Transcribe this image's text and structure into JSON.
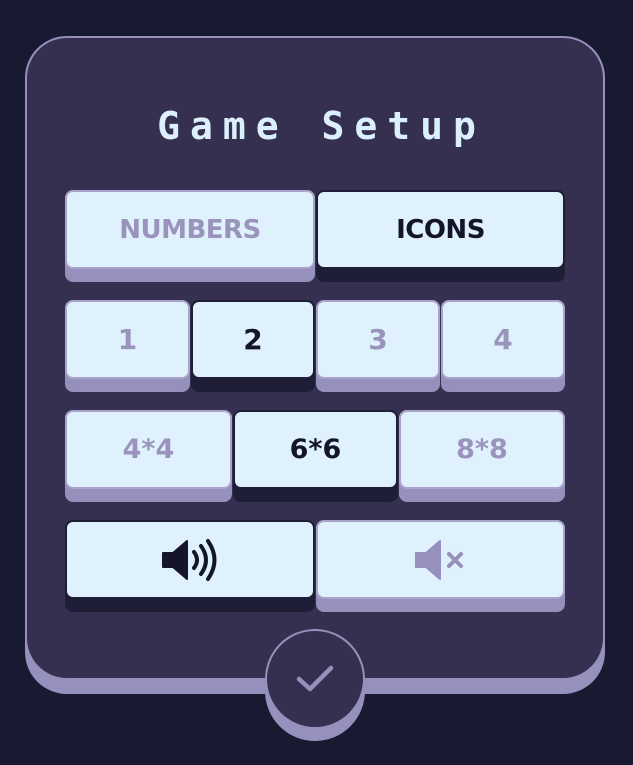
{
  "panel": {
    "title": "Game Setup"
  },
  "theme_row": {
    "options": [
      {
        "label": "NUMBERS",
        "selected": false
      },
      {
        "label": "ICONS",
        "selected": true
      }
    ]
  },
  "players_row": {
    "options": [
      {
        "label": "1",
        "selected": false
      },
      {
        "label": "2",
        "selected": true
      },
      {
        "label": "3",
        "selected": false
      },
      {
        "label": "4",
        "selected": false
      }
    ]
  },
  "grid_row": {
    "options": [
      {
        "label": "4*4",
        "selected": false
      },
      {
        "label": "6*6",
        "selected": true
      },
      {
        "label": "8*8",
        "selected": false
      }
    ]
  },
  "sound_row": {
    "options": [
      {
        "icon": "speaker-on-icon",
        "selected": true
      },
      {
        "icon": "speaker-muted-icon",
        "selected": false
      }
    ]
  },
  "confirm": {
    "icon": "checkmark-icon"
  },
  "colors": {
    "background": "#181a31",
    "panel": "#35304f",
    "panel_edge": "#9690bc",
    "button_face": "#dff1fd",
    "selected_text": "#141528",
    "unselected_text": "#9a94bd"
  }
}
